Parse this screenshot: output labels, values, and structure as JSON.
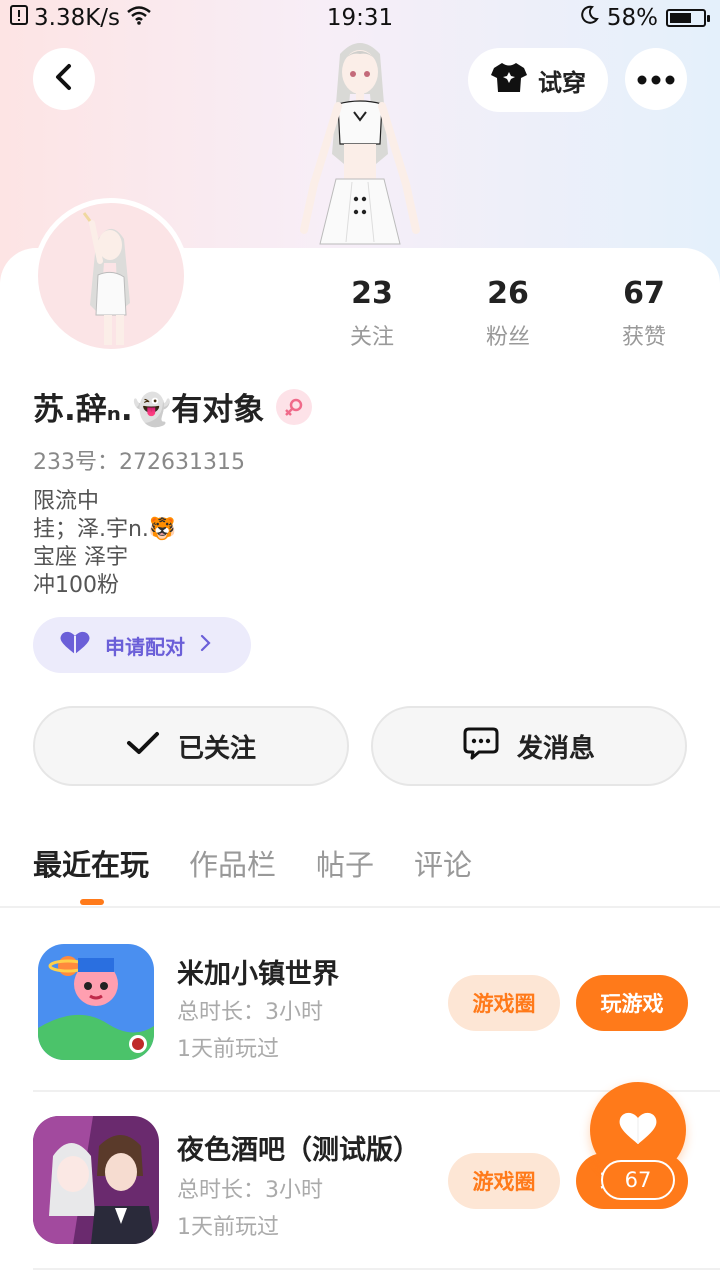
{
  "status_bar": {
    "net_speed": "3.38K/s",
    "time": "19:31",
    "battery_percent": "58%",
    "battery_level": 0.58
  },
  "header": {
    "try_on_label": "试穿"
  },
  "stats": [
    {
      "value": "23",
      "label": "关注"
    },
    {
      "value": "26",
      "label": "粉丝"
    },
    {
      "value": "67",
      "label": "获赞"
    }
  ],
  "profile": {
    "name": "苏.辞ₙ.👻有对象",
    "uid": "233号：272631315",
    "bio_lines": [
      "限流中",
      "挂；泽.宇n.🐯",
      "宝座 泽宇",
      "冲100粉"
    ],
    "pair_label": "申请配对"
  },
  "actions": {
    "follow_label": "已关注",
    "message_label": "发消息"
  },
  "tabs": [
    "最近在玩",
    "作品栏",
    "帖子",
    "评论"
  ],
  "games": [
    {
      "title": "米加小镇世界",
      "duration": "总时长：3小时",
      "last_played": "1天前玩过",
      "circle_label": "游戏圈",
      "play_label": "玩游戏"
    },
    {
      "title": "夜色酒吧（测试版）",
      "duration": "总时长：3小时",
      "last_played": "1天前玩过",
      "circle_label": "游戏圈",
      "play_label": "玩游戏"
    }
  ],
  "like_fab": {
    "count": "67"
  },
  "colors": {
    "accent": "#ff7a1a",
    "pair": "#6b5fd8"
  },
  "icons": [
    "back-icon",
    "tshirt-icon",
    "more-icon",
    "heart-icon",
    "check-icon",
    "chat-icon",
    "female-icon",
    "wifi-icon",
    "moon-icon"
  ]
}
